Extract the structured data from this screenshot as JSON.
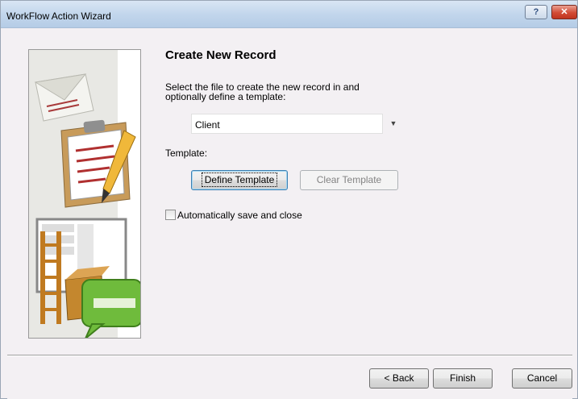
{
  "window": {
    "title": "WorkFlow Action Wizard",
    "help_label": "?",
    "close_label": "✕"
  },
  "main": {
    "heading": "Create New Record",
    "instruction_line1": "Select the file to create the new record in and",
    "instruction_line2": "optionally define a template:",
    "file_combo": {
      "value": "Client"
    },
    "template_label": "Template:",
    "define_template_label": "Define Template",
    "clear_template_label": "Clear Template",
    "auto_save": {
      "label": "Automatically save and close",
      "checked": false
    }
  },
  "footer": {
    "back_label": "< Back",
    "finish_label": "Finish",
    "cancel_label": "Cancel"
  },
  "colors": {
    "titlebar": "#c2d6ec",
    "close_button": "#d24b35",
    "dialog_bg": "#f3f0f3",
    "focus_border": "#3c7fb1"
  }
}
